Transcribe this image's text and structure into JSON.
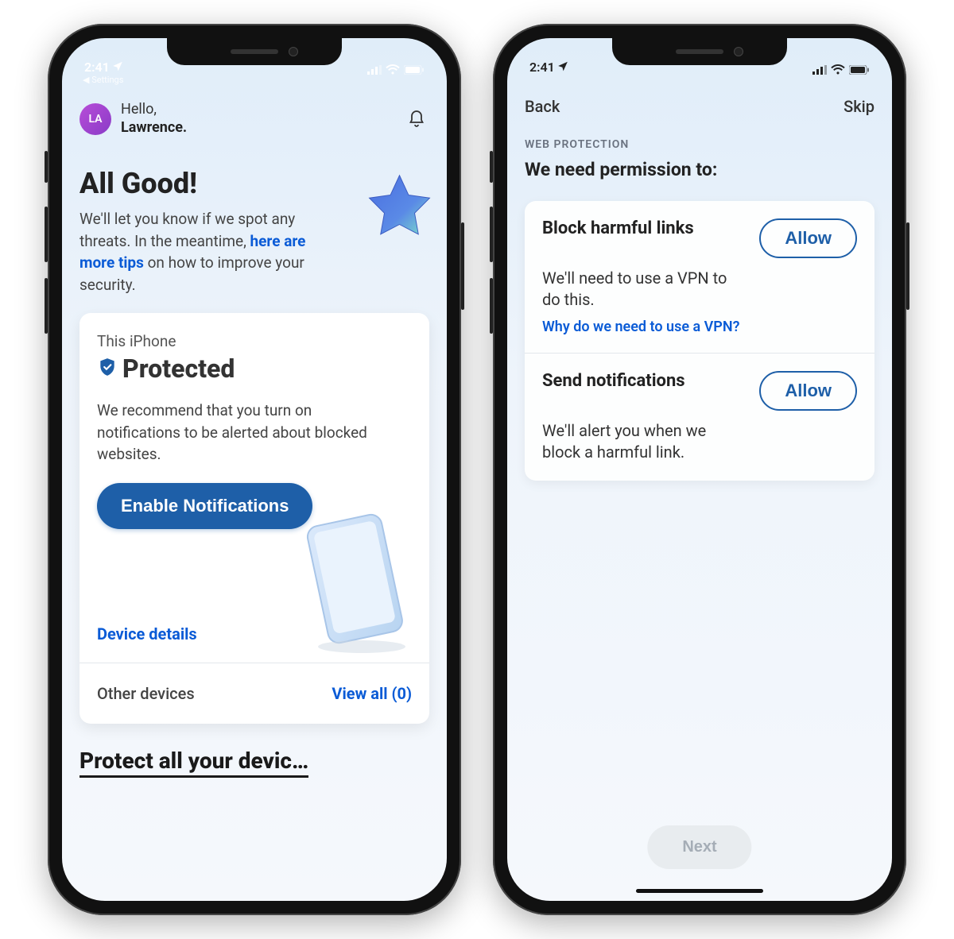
{
  "status": {
    "time": "2:41",
    "back_settings": "Settings"
  },
  "phone1": {
    "avatar_initials": "LA",
    "greeting": "Hello,",
    "name": "Lawrence.",
    "headline": "All Good!",
    "summary_1": "We'll let you know if we spot any threats. In the meantime, ",
    "tips_link": "here are more tips",
    "summary_2": " on how to improve your security.",
    "card": {
      "device_label": "This iPhone",
      "status": "Protected",
      "recommendation": "We recommend that you turn on notifications to be alerted about blocked websites.",
      "enable_button": "Enable Notifications",
      "device_details": "Device details",
      "other_devices": "Other devices",
      "view_all": "View all (0)"
    },
    "bottom_text": "Protect all your devic…"
  },
  "phone2": {
    "nav_back": "Back",
    "nav_skip": "Skip",
    "section_label": "WEB PROTECTION",
    "section_title": "We need permission to:",
    "permissions": [
      {
        "title": "Block harmful links",
        "button": "Allow",
        "desc": "We'll need to use a VPN to do this.",
        "link": "Why do we need to use a VPN?"
      },
      {
        "title": "Send notifications",
        "button": "Allow",
        "desc": "We'll alert you when we block a harmful link."
      }
    ],
    "next_button": "Next"
  }
}
